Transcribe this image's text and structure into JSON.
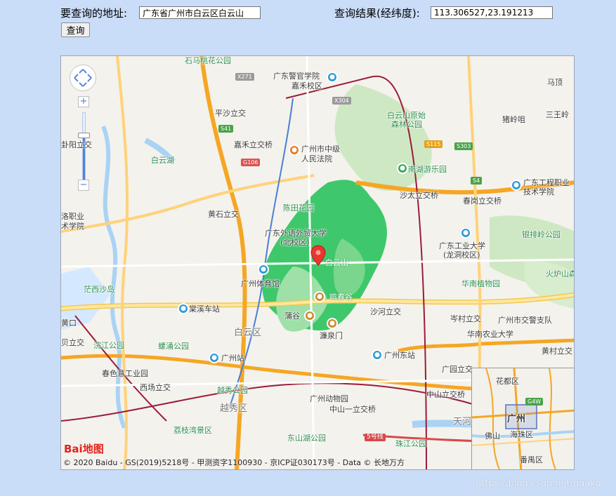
{
  "form": {
    "address_label": "要查询的地址:",
    "address_value": "广东省广州市白云区白云山",
    "result_label": "查询结果(经纬度):",
    "result_value": "113.306527,23.191213",
    "query_button": "查询"
  },
  "map": {
    "places": {
      "shimatao": "石马桃花公园",
      "gd_police": "广东警官学院",
      "gd_police2": "嘉禾校区",
      "pingsha": "平沙立交",
      "jiahe": "嘉禾立交桥",
      "court": "广州市中级",
      "court2": "人民法院",
      "baiyunshan_park": "白云山原始",
      "baiyunshan_park2": "森林公园",
      "mafengling": "马顶",
      "zhulingling": "猪岭咀",
      "sanwangling": "三王岭",
      "xiefengli": "卦阳立交",
      "baiyun_lake": "白云湖",
      "nanhu": "南湖游乐园",
      "gd_eng": "广东工程职业",
      "gd_eng2": "技术学院",
      "shatai": "沙太立交桥",
      "chengang": "春岗立交桥",
      "huangshi": "黄石立交",
      "chentian": "陈田花园",
      "gdufs": "广东外语外贸大学",
      "gdufs2": "(北校区)",
      "luoxiao": "洛职业",
      "luoxiao2": "术学院",
      "gdut": "广东工业大学",
      "gdut2": "(龙洞校区)",
      "yinpai": "银排岭公园",
      "baiyunshan": "白云山",
      "gz_gym": "广州体育馆",
      "huonan": "华南植物园",
      "huoyan": "火炉山森",
      "qixisha": "茫西沙岛",
      "mingchungu": "鸣春谷",
      "tangchong": "棠溪车站",
      "shahe": "沙河立交",
      "cenlun": "岑村立交",
      "traffic": "广州市交警支队",
      "pugu": "蒲谷",
      "baiyun_dist": "白云区",
      "lianquan": "濂泉门",
      "huanong": "华南农业大学",
      "beili": "贝立交",
      "liujiang": "浣江公园",
      "liuyong": "螺涌公园",
      "huangcun": "黄村立交",
      "chunyiyi": "春色意工业园",
      "gz_station": "广州站",
      "gz_east": "广州东站",
      "guangyuan": "广园立交",
      "xichang": "西场立交",
      "yuexiu_park": "越秀公园",
      "gz_zoo": "广州动物园",
      "zhongshan_lijiao": "中山立交桥",
      "zhongshan1": "中山一立交桥",
      "yuexiu_dist": "越秀区",
      "tianhe": "天河",
      "lizhiwan": "荔枝湾景区",
      "line5": "5号线",
      "zhuyun": "珠江公园",
      "dongshan": "东山湖公园",
      "huangpo": "黄口"
    },
    "shields": {
      "x271": "X271",
      "x304": "X304",
      "s41": "S41",
      "g106": "G106",
      "s115": "S115",
      "s303": "S303",
      "s4": "S4"
    },
    "minimap": {
      "huadu": "花都区",
      "guangzhou": "广州",
      "foshan": "佛山",
      "haizhu": "海珠区",
      "panyu": "番禺区",
      "g4w": "G4W"
    },
    "logo": "Bai地图",
    "copyright": "© 2020 Baidu - GS(2019)5218号 - 甲测资字1100930 - 京ICP证030173号 - Data © 长地万方"
  },
  "watermark": "https://blog.csdn.net/qaakd",
  "colors": {
    "page_bg": "#c9dcf8",
    "park_green": "#cfe8c4",
    "baiyunshan_green": "#3ec86b",
    "highway_orange": "#f5a623",
    "marker_red": "#e8372d"
  }
}
